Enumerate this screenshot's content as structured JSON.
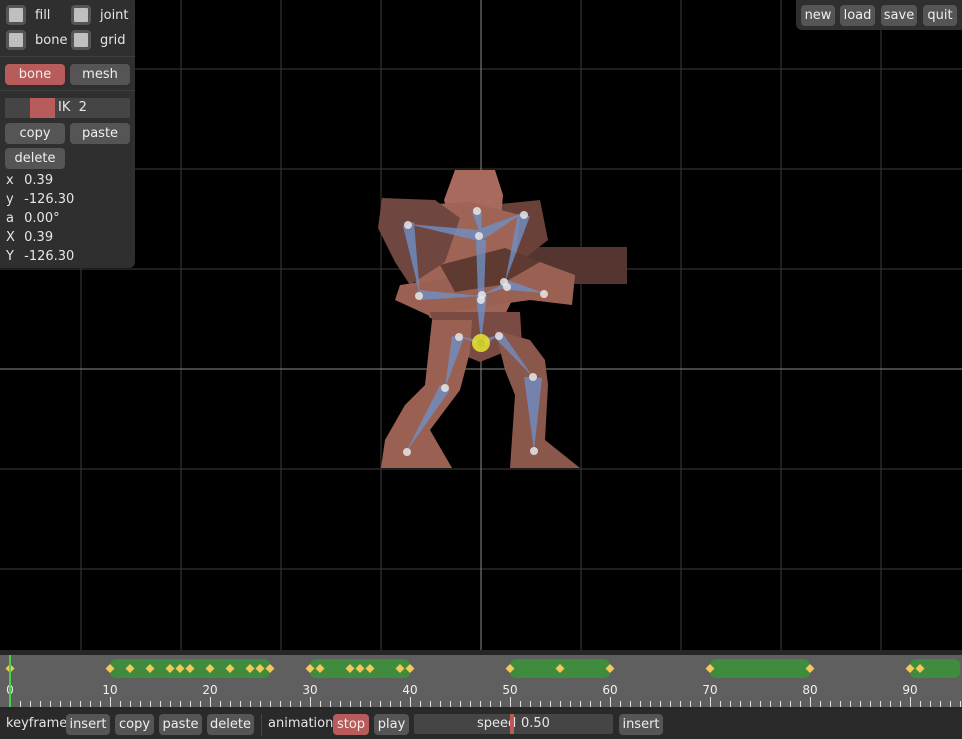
{
  "display_toggles": {
    "fill": "fill",
    "joint": "joint",
    "bone": "bone",
    "grid": "grid"
  },
  "mode_tabs": {
    "bone": "bone",
    "mesh": "mesh",
    "active": "bone"
  },
  "ik": {
    "label": "IK",
    "value": "2"
  },
  "edit_actions": {
    "copy": "copy",
    "paste": "paste",
    "delete": "delete"
  },
  "properties": [
    {
      "key": "x",
      "value": "0.39"
    },
    {
      "key": "y",
      "value": "-126.30"
    },
    {
      "key": "a",
      "value": "0.00°"
    },
    {
      "key": "X",
      "value": "0.39"
    },
    {
      "key": "Y",
      "value": "-126.30"
    }
  ],
  "file_menu": {
    "new": "new",
    "load": "load",
    "save": "save",
    "quit": "quit"
  },
  "timeline": {
    "current_frame": 0,
    "tick_labels": [
      "0",
      "10",
      "20",
      "30",
      "40",
      "50",
      "60",
      "70",
      "80",
      "90"
    ],
    "keyframes": [
      0,
      10,
      12,
      14,
      16,
      17,
      18,
      20,
      22,
      24,
      25,
      26,
      30,
      31,
      34,
      35,
      36,
      39,
      40,
      50,
      55,
      60,
      70,
      80,
      90,
      91
    ],
    "segments": [
      [
        10,
        26
      ],
      [
        30,
        40
      ],
      [
        50,
        60
      ],
      [
        70,
        80
      ],
      [
        90,
        95
      ]
    ],
    "colors": {
      "segment": "#3f8c3f",
      "keyframe": "#f3c85a",
      "cursor": "#47d147"
    }
  },
  "bottom_bar": {
    "keyframe_label": "keyframe",
    "insert": "insert",
    "copy": "copy",
    "paste": "paste",
    "delete": "delete",
    "animation_label": "animation",
    "stop": "stop",
    "play": "play",
    "speed_label": "speed",
    "speed_value": "0.50",
    "speed_insert": "insert"
  },
  "colors": {
    "accent": "#b85b5b",
    "background": "#000000",
    "bone": "#6f8fc4",
    "mesh_light": "#a86a5c",
    "mesh_dark": "#5e3a31",
    "selected_joint": "#e6e62e"
  }
}
